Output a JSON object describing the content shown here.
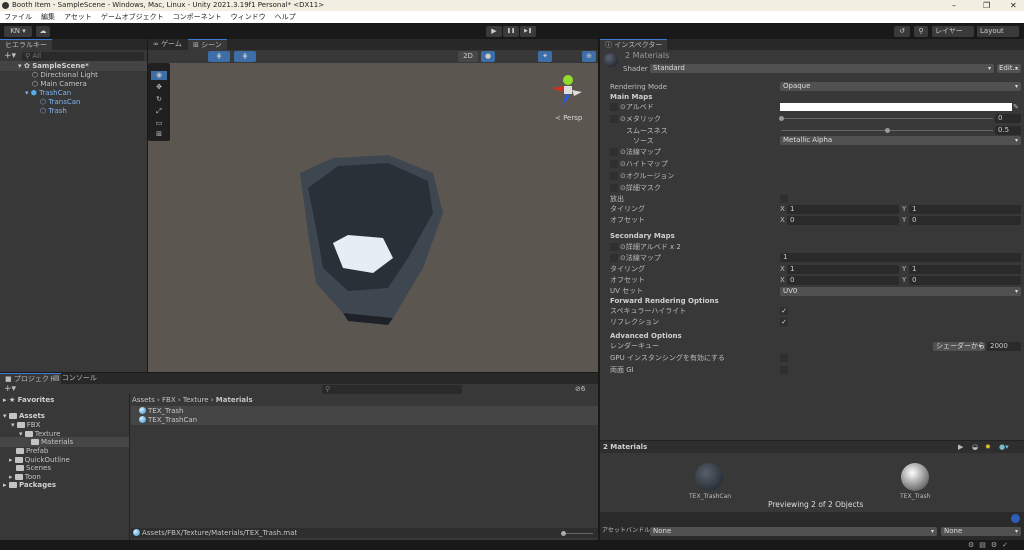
{
  "window": {
    "title": "Booth Item - SampleScene - Windows, Mac, Linux - Unity 2021.3.19f1 Personal* <DX11>",
    "minimize": "–",
    "restore": "❐",
    "close": "✕"
  },
  "menu": [
    "ファイル",
    "編集",
    "アセット",
    "ゲームオブジェクト",
    "コンポーネント",
    "ウィンドウ",
    "ヘルプ"
  ],
  "toolbar": {
    "account": "KN ▾",
    "play": "▶",
    "pause": "❚❚",
    "step": "▶❚",
    "layers": "レイヤー",
    "layout": "Layout"
  },
  "hierarchy": {
    "tab": "ヒエラルキー",
    "search_placeholder": "All",
    "items": [
      {
        "label": "SampleScene*"
      },
      {
        "label": "Directional Light"
      },
      {
        "label": "Main Camera"
      },
      {
        "label": "TrashCan"
      },
      {
        "label": "TransCan"
      },
      {
        "label": "Trash"
      }
    ]
  },
  "scene": {
    "tabs": [
      "ゲーム",
      "シーン"
    ],
    "btn_2d": "2D",
    "persp": "≺ Persp"
  },
  "inspector": {
    "tab": "インスペクター",
    "title": "2 Materials",
    "shader_label": "Shader",
    "shader": "Standard",
    "edit": "Edit...",
    "rendering_mode_label": "Rendering Mode",
    "rendering_mode": "Opaque",
    "main_maps": "Main Maps",
    "albedo": "⊙アルベド",
    "metallic": "⊙メタリック",
    "metallic_value": "0",
    "smoothness": "スムースネス",
    "smoothness_value": "0.5",
    "source": "ソース",
    "source_value": "Metallic Alpha",
    "normal_map": "⊙法線マップ",
    "height_map": "⊙ハイトマップ",
    "occlusion": "⊙オクルージョン",
    "detail_mask": "⊙詳細マスク",
    "emission": "放出",
    "tiling": "タイリング",
    "offset": "オフセット",
    "x": "X",
    "y": "Y",
    "tiling_x": "1",
    "tiling_y": "1",
    "offset_x": "0",
    "offset_y": "0",
    "secondary_maps": "Secondary Maps",
    "detail_albedo": "⊙詳細アルベド x 2",
    "sec_normal": "⊙法線マップ",
    "sec_normal_value": "1",
    "sec_tiling_x": "1",
    "sec_tiling_y": "1",
    "sec_offset_x": "0",
    "sec_offset_y": "0",
    "uv_set_label": "UV セット",
    "uv_set": "UV0",
    "forward": "Forward Rendering Options",
    "specular": "スペキュラーハイライト",
    "reflections": "リフレクション",
    "advanced": "Advanced Options",
    "render_queue": "レンダーキュー",
    "render_queue_mode": "シェーダーから",
    "render_queue_value": "2000",
    "gpu_instancing": "GPU インスタンシングを有効にする",
    "double_gi": "両面 GI",
    "preview_title": "2 Materials",
    "previews": [
      "TEX_TrashCan",
      "TEX_Trash"
    ],
    "previewing": "Previewing 2 of 2 Objects",
    "asset_bundle_label": "アセットバンドル",
    "asset_bundle": "None",
    "asset_variant": "None"
  },
  "project": {
    "tabs": [
      "プロジェクト",
      "コンソール"
    ],
    "tree": [
      "Favorites",
      "Assets",
      "FBX",
      "Texture",
      "Materials",
      "Prefab",
      "QuickOutline",
      "Scenes",
      "Toon",
      "Packages"
    ],
    "breadcrumb": [
      "Assets",
      "FBX",
      "Texture",
      "Materials"
    ],
    "files": [
      "TEX_Trash",
      "TEX_TrashCan"
    ],
    "status_path": "Assets/FBX/Texture/Materials/TEX_Trash.mat",
    "hidden_count": "6"
  },
  "colors": {
    "accent": "#3d7bd6",
    "panel": "#383838",
    "viewport": "#5b5650"
  }
}
